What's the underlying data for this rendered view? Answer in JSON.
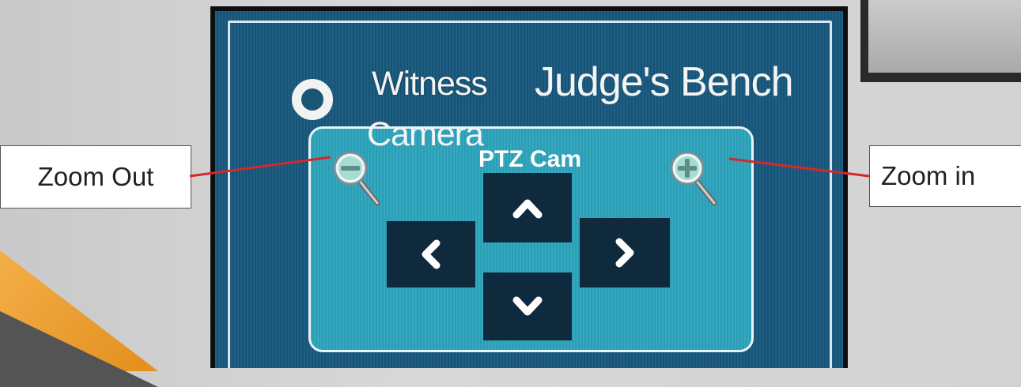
{
  "display": {
    "radio_option_label_line1": "Witness",
    "radio_option_label_line2": "Camera",
    "selected_camera_label": "Judge's Bench",
    "ptz_panel_title": "PTZ Cam"
  },
  "controls": {
    "zoom_out_icon": "zoom-out-magnifier-icon",
    "zoom_in_icon": "zoom-in-magnifier-icon",
    "pan_up_icon": "chevron-up-icon",
    "pan_down_icon": "chevron-down-icon",
    "pan_left_icon": "chevron-left-icon",
    "pan_right_icon": "chevron-right-icon"
  },
  "annotations": {
    "zoom_out_label": "Zoom Out",
    "zoom_in_label": "Zoom in"
  },
  "colors": {
    "screen_background": "#1f5f86",
    "panel_background": "#33a8bf",
    "button_background": "#0e2a3c",
    "leader_line": "#d62828",
    "slide_accent": "#e38e1d"
  }
}
